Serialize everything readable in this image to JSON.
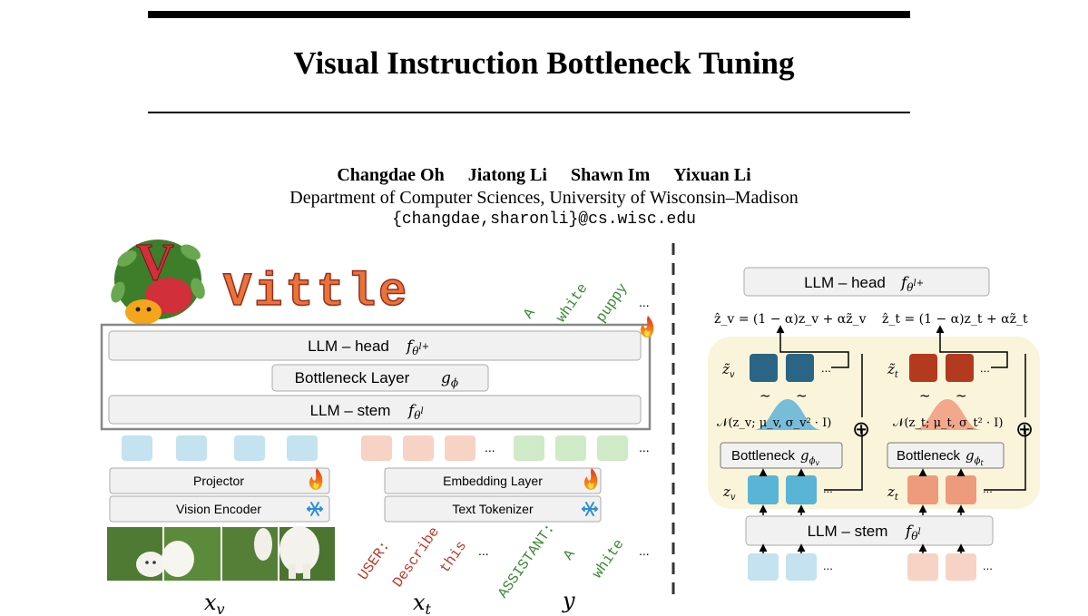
{
  "paper": {
    "title": "Visual Instruction Bottleneck Tuning",
    "authors": [
      "Changdae Oh",
      "Jiatong Li",
      "Shawn Im",
      "Yixuan Li"
    ],
    "affiliation": "Department of Computer Sciences, University of Wisconsin–Madison",
    "email": "{changdae,sharonli}@cs.wisc.edu"
  },
  "figure": {
    "logo": {
      "text": "Vittle",
      "letter": "V"
    },
    "left": {
      "llm_head": "LLM – head",
      "bottleneck": "Bottleneck Layer",
      "llm_stem": "LLM – stem",
      "projector": "Projector",
      "vision_encoder": "Vision Encoder",
      "embedding_layer": "Embedding Layer",
      "text_tokenizer": "Text Tokenizer",
      "ellipsis": "...",
      "output_tokens": [
        "A",
        "white",
        "puppy"
      ],
      "input_user_tokens": [
        "USER:",
        "Describe",
        "this"
      ],
      "input_assistant_tokens": [
        "ASSISTANT:",
        "A",
        "white"
      ],
      "label_xv": "x",
      "label_xv_sub": "v",
      "label_xt": "x",
      "label_xt_sub": "t",
      "label_y": "y"
    },
    "right": {
      "llm_head": "LLM – head",
      "llm_stem": "LLM – stem",
      "bottleneck_label": "Bottleneck",
      "ellipsis": "...",
      "eq_v": "ẑ_v = (1 − α)z_v + αz̃_v",
      "eq_t": "ẑ_t = (1 − α)z_t + αz̃_t",
      "gauss_v": "𝒩(z_v; μ_v, σ_v² · I)",
      "gauss_t": "𝒩(z_t; μ_t, σ_t² · I)",
      "tilde_symbol": "~",
      "plus_symbol": "⊕"
    },
    "colors": {
      "vision_light": "#c4e2ef",
      "text_light": "#f7d3c5",
      "answer_light": "#cfeac7",
      "vision_dark": "#2a6585",
      "text_dark": "#b3391f",
      "vision_mid": "#5ab4d5",
      "text_mid": "#ee9a7c",
      "bottleneck_panel": "#faf5da",
      "box_fill": "#f1f1f1",
      "token_user": "#c0392b",
      "token_assistant": "#3a8a35"
    }
  }
}
